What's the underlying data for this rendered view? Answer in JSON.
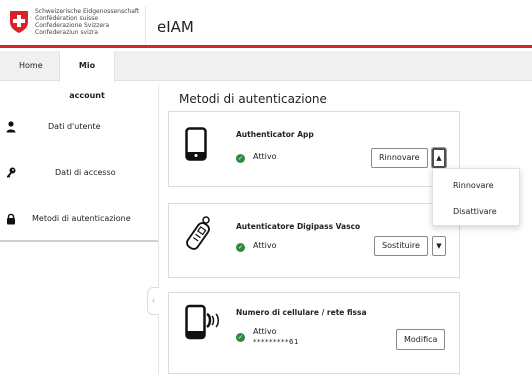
{
  "header": {
    "confederation_lines": [
      "Schweizerische Eidgenossenschaft",
      "Confédération suisse",
      "Confederazione Svizzera",
      "Confederaziun svizra"
    ],
    "app_title": "eIAM",
    "brand_color": "#d8232a"
  },
  "tabs": [
    {
      "label": "Home"
    },
    {
      "label": "Mio account",
      "active": true
    }
  ],
  "sidebar": {
    "items": [
      {
        "label": "Dati d'utente",
        "icon": "user-icon"
      },
      {
        "label": "Dati di accesso",
        "icon": "key-icon"
      },
      {
        "label": "Metodi di autenticazione",
        "icon": "lock-icon",
        "active": true
      }
    ],
    "collapse_glyph": "‹"
  },
  "main": {
    "title": "Metodi di autenticazione",
    "cards": [
      {
        "title": "Authenticator App",
        "status": "Attivo",
        "icon": "smartphone-icon",
        "button": "Rinnovare",
        "caret": "▲"
      },
      {
        "title": "Autenticatore Digipass Vasco",
        "status": "Attivo",
        "icon": "digipass-token-icon",
        "button": "Sostituire",
        "caret": "▼"
      },
      {
        "title": "Numero di cellulare / rete fissa",
        "status": "Attivo",
        "masked_number": "*********61",
        "icon": "phone-signal-icon",
        "button": "Modifica"
      }
    ],
    "status_color": "#2e8b3e"
  },
  "dropdown": {
    "items": [
      {
        "label": "Rinnovare"
      },
      {
        "label": "Disattivare"
      }
    ]
  }
}
